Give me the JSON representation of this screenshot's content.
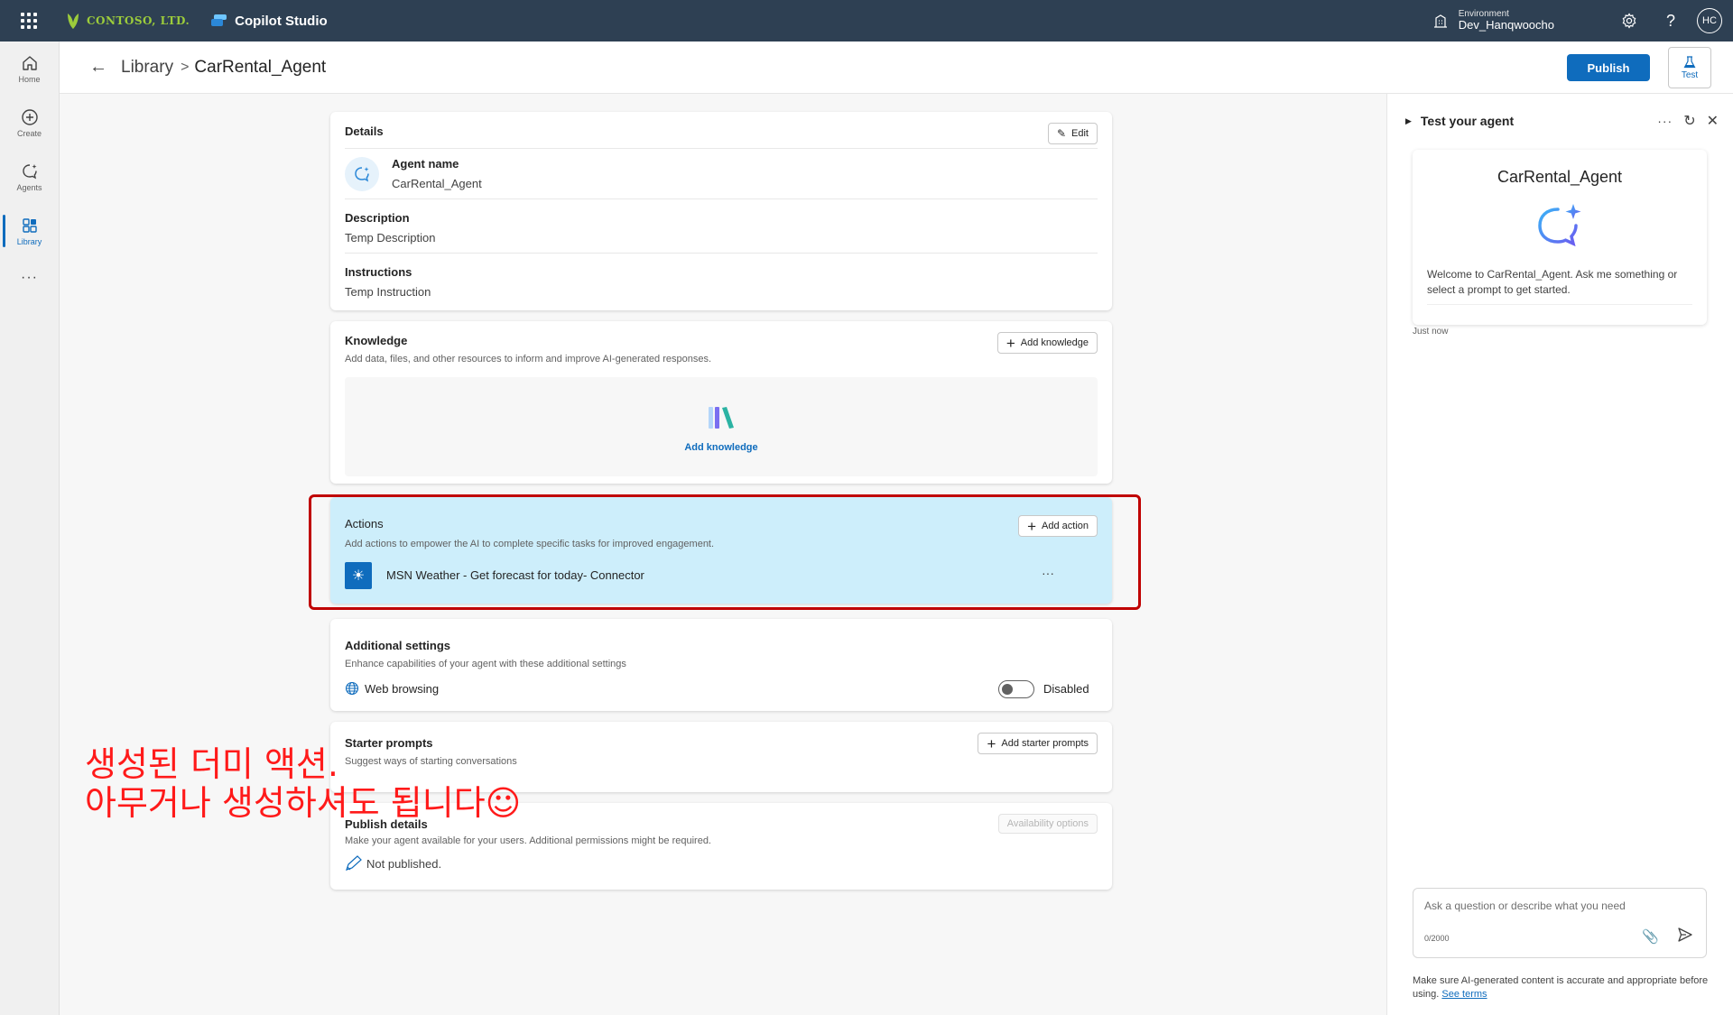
{
  "topbar": {
    "brand": "CONTOSO, LTD.",
    "product": "Copilot Studio",
    "env_label": "Environment",
    "env_value": "Dev_Hanqwoocho",
    "avatar_initials": "HC",
    "colors": {
      "bar": "#2e4053",
      "brand_green": "#9ccc3b"
    }
  },
  "rail": {
    "items": [
      {
        "label": "Home",
        "icon": "home-icon"
      },
      {
        "label": "Create",
        "icon": "plus-circle-icon"
      },
      {
        "label": "Agents",
        "icon": "agents-icon"
      },
      {
        "label": "Library",
        "icon": "library-icon",
        "active": true
      }
    ],
    "more": "···"
  },
  "header": {
    "breadcrumb_root": "Library",
    "separator": ">",
    "current": "CarRental_Agent",
    "publish_label": "Publish",
    "test_label": "Test",
    "accent": "#0f6cbd"
  },
  "details": {
    "title": "Details",
    "edit_label": "Edit",
    "agent_name_label": "Agent name",
    "agent_name_value": "CarRental_Agent",
    "description_label": "Description",
    "description_value": "Temp Description",
    "instructions_label": "Instructions",
    "instructions_value": "Temp Instruction"
  },
  "knowledge": {
    "title": "Knowledge",
    "subtitle": "Add data, files, and other resources to inform and improve AI-generated responses.",
    "add_button": "Add knowledge",
    "empty_link": "Add knowledge"
  },
  "actions": {
    "title": "Actions",
    "subtitle": "Add actions to empower the AI to complete specific tasks for improved engagement.",
    "add_button": "Add action",
    "items": [
      {
        "name": "MSN Weather - Get forecast for today- Connector",
        "more": "···"
      }
    ],
    "highlight_bg": "#cdeefb"
  },
  "additional_settings": {
    "title": "Additional settings",
    "subtitle": "Enhance capabilities of your agent with these additional settings",
    "web_browsing_label": "Web browsing",
    "toggle_state": "Disabled"
  },
  "starter_prompts": {
    "title": "Starter prompts",
    "subtitle": "Suggest ways of starting conversations",
    "add_button": "Add starter prompts"
  },
  "publish_details": {
    "title": "Publish details",
    "subtitle": "Make your agent available for your users. Additional permissions might be required.",
    "availability_button": "Availability options",
    "status": "Not published."
  },
  "test_panel": {
    "title": "Test your agent",
    "agent_name": "CarRental_Agent",
    "welcome": "Welcome to CarRental_Agent. Ask me something or select a prompt to get started.",
    "timestamp": "Just now",
    "input_placeholder": "Ask a question or describe what you need",
    "char_count": "0/2000",
    "disclaimer": "Make sure AI-generated content is accurate and appropriate before using.",
    "see_terms": "See terms"
  },
  "annotation": {
    "line1": "생성된 더미 액션.",
    "line2": "아무거나 생성하셔도 됩니다☺",
    "color": "#ff1a1a"
  }
}
